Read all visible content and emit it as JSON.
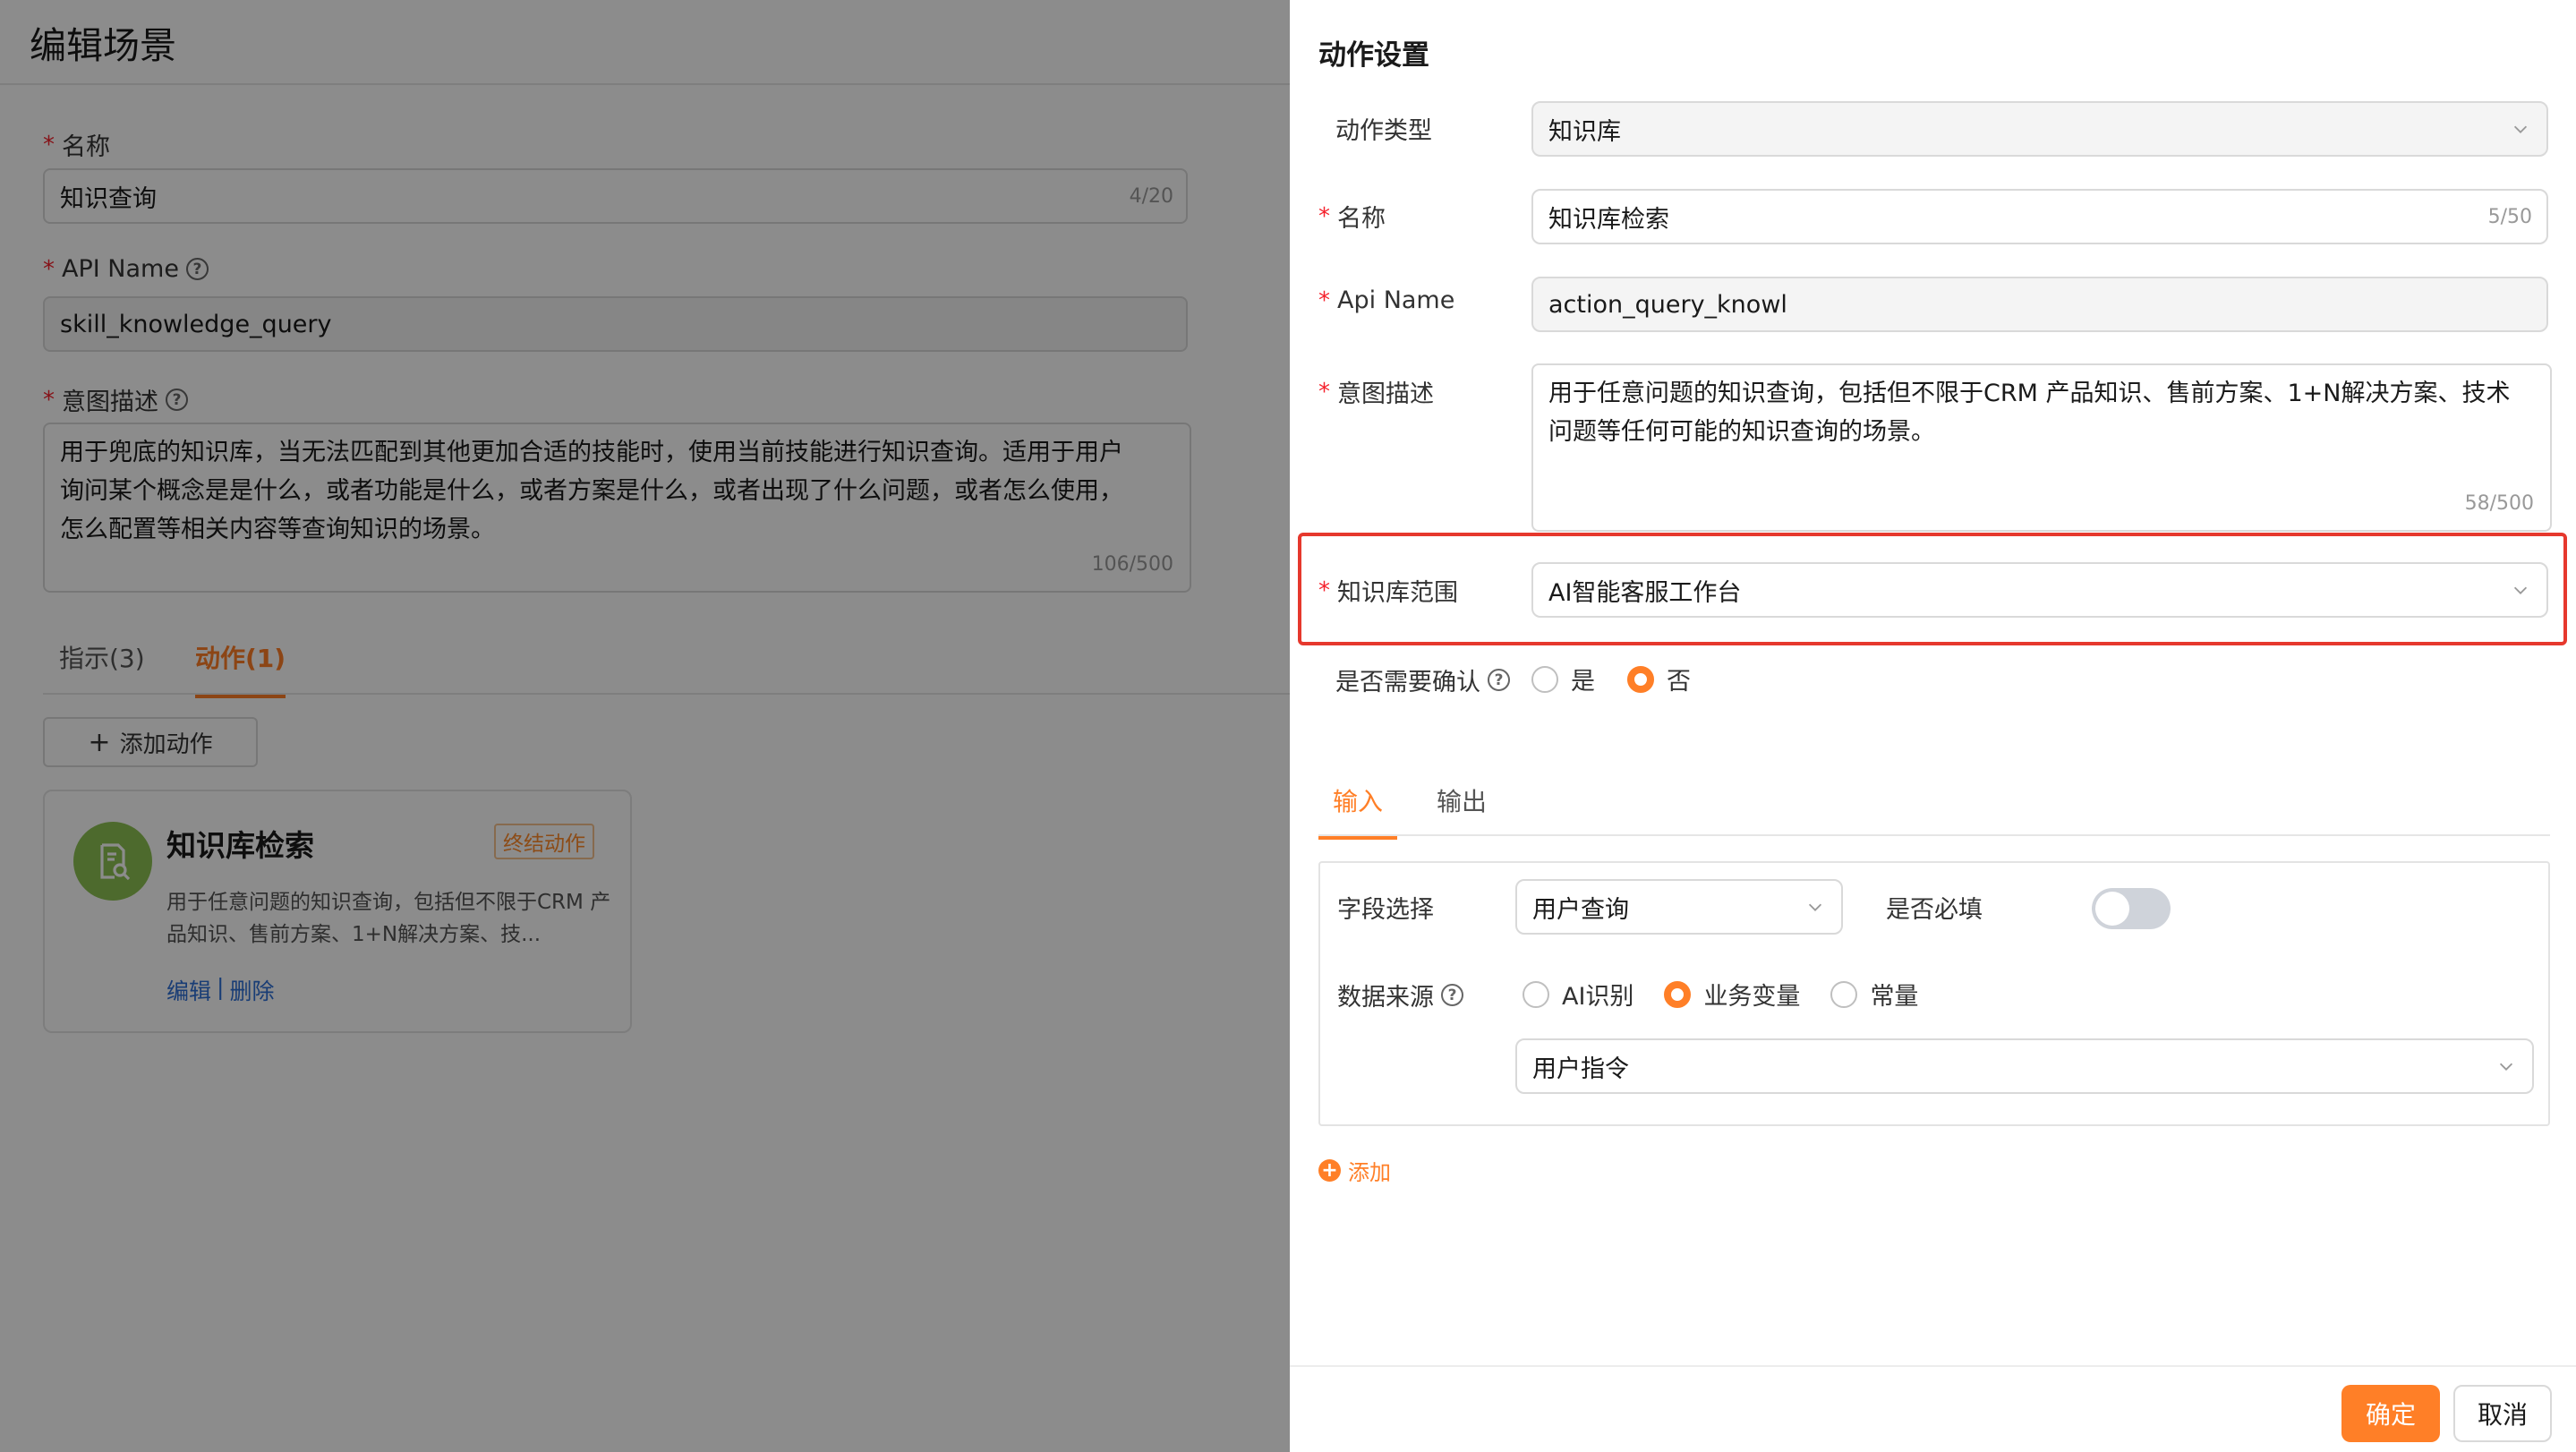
{
  "page": {
    "title": "编辑场景",
    "name": {
      "label": "名称",
      "value": "知识查询",
      "counter": "4/20"
    },
    "api_name": {
      "label": "API Name",
      "value": "skill_knowledge_query"
    },
    "intent": {
      "label": "意图描述",
      "lines": [
        "用于兜底的知识库，当无法匹配到其他更加合适的技能时，使用当前技能进行知识查询。适用于用户",
        "询问某个概念是是什么，或者功能是什么，或者方案是什么，或者出现了什么问题，或者怎么使用，",
        "怎么配置等相关内容等查询知识的场景。"
      ],
      "counter": "106/500"
    },
    "tabs": [
      {
        "label": "指示(3)"
      },
      {
        "label": "动作(1)"
      }
    ],
    "add_action_label": "添加动作",
    "card": {
      "title": "知识库检索",
      "badge": "终结动作",
      "desc": "用于任意问题的知识查询，包括但不限于CRM 产品知识、售前方案、1+N解决方案、技...",
      "edit": "编辑",
      "sep": "|",
      "delete": "删除"
    }
  },
  "drawer": {
    "title": "动作设置",
    "action_type": {
      "label": "动作类型",
      "value": "知识库"
    },
    "name": {
      "label": "名称",
      "value": "知识库检索",
      "counter": "5/50"
    },
    "api_name": {
      "label": "Api Name",
      "value": "action_query_knowl"
    },
    "intent": {
      "label": "意图描述",
      "lines": [
        "用于任意问题的知识查询，包括但不限于CRM 产品知识、售前方案、1+N解决方案、技术",
        "问题等任何可能的知识查询的场景。"
      ],
      "counter": "58/500"
    },
    "kb_scope": {
      "label": "知识库范围",
      "value": "AI智能客服工作台"
    },
    "confirm": {
      "label": "是否需要确认",
      "options": [
        "是",
        "否"
      ],
      "selected": "否"
    },
    "tabs": [
      {
        "label": "输入"
      },
      {
        "label": "输出"
      }
    ],
    "field_select": {
      "label": "字段选择",
      "value": "用户查询"
    },
    "required": {
      "label": "是否必填",
      "on": false
    },
    "data_source": {
      "label": "数据来源",
      "options": [
        "AI识别",
        "业务变量",
        "常量"
      ],
      "selected": "业务变量"
    },
    "variable": {
      "value": "用户指令"
    },
    "add_label": "添加",
    "ok_label": "确定",
    "cancel_label": "取消"
  },
  "colors": {
    "accent": "#ff7f27",
    "highlight": "#e6382d",
    "avatar": "#8cc152",
    "link": "#2f6fd6"
  }
}
